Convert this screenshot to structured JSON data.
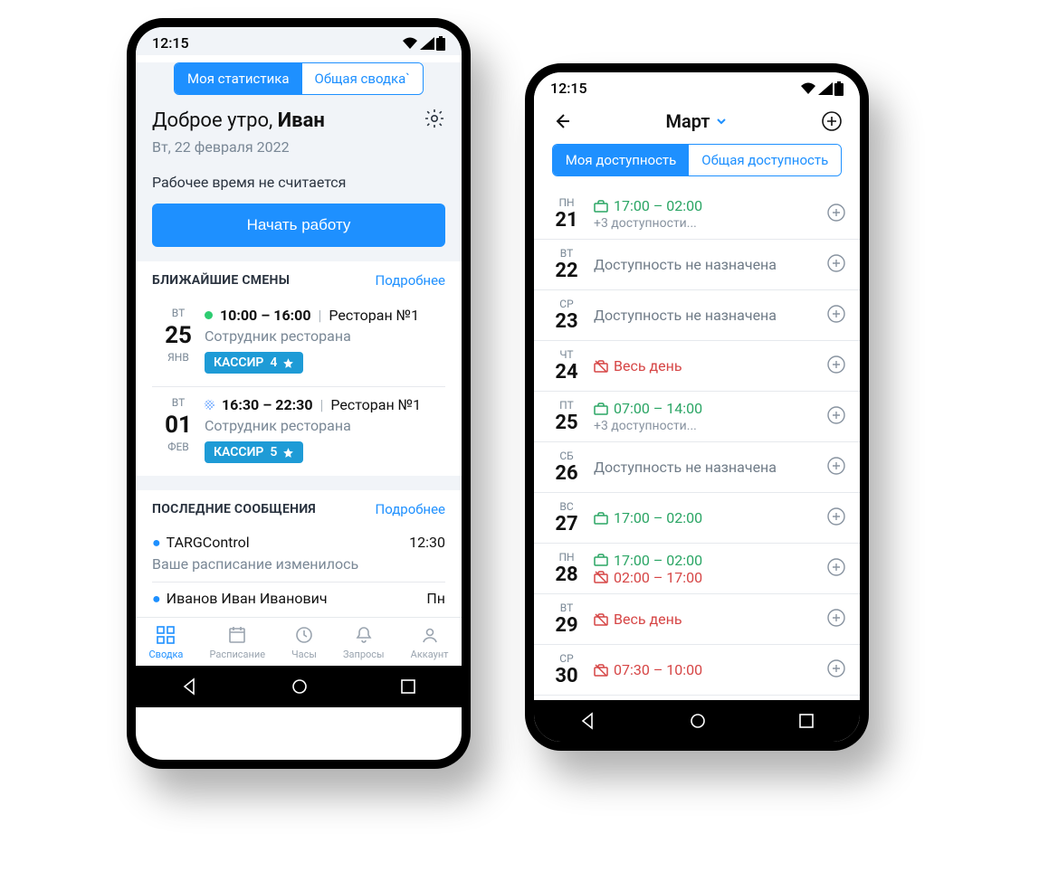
{
  "status": {
    "time": "12:15"
  },
  "left": {
    "tabs": {
      "my": "Моя статистика",
      "overall": "Общая сводка`"
    },
    "greeting_pre": "Доброе утро, ",
    "greeting_name": "Иван",
    "date": "Вт, 22 февраля 2022",
    "worktime": "Рабочее время не считается",
    "start_btn": "Начать работу",
    "shifts_title": "БЛИЖАЙШИЕ СМЕНЫ",
    "more": "Подробнее",
    "shifts": [
      {
        "wd": "ВТ",
        "dn": "25",
        "mn": "ЯНВ",
        "time": "10:00 – 16:00",
        "place": "Ресторан №1",
        "role": "Сотрудник ресторана",
        "badge_text": "КАССИР",
        "badge_num": "4",
        "dot": "green"
      },
      {
        "wd": "ВТ",
        "dn": "01",
        "mn": "ФЕВ",
        "time": "16:30 – 22:30",
        "place": "Ресторан №1",
        "role": "Сотрудник ресторана",
        "badge_text": "КАССИР",
        "badge_num": "5",
        "dot": "pattern"
      }
    ],
    "msgs_title": "ПОСЛЕДНИЕ СООБЩЕНИЯ",
    "msgs": [
      {
        "from": "TARGControl",
        "time": "12:30",
        "text": "Ваше расписание изменилось"
      },
      {
        "from": "Иванов Иван Иванович",
        "time": "Пн",
        "text": ""
      }
    ],
    "tabbar": {
      "summary": "Сводка",
      "schedule": "Расписание",
      "hours": "Часы",
      "requests": "Запросы",
      "account": "Аккаунт"
    }
  },
  "right": {
    "month": "Март",
    "tabs": {
      "my": "Моя доступность",
      "overall": "Общая доступность"
    },
    "none": "Доступность не назначена",
    "more_tpl": "+3 доступности...",
    "days": [
      {
        "wd": "ПН",
        "dn": "21",
        "slots": [
          {
            "t": "green",
            "text": "17:00 – 02:00"
          }
        ],
        "more": true
      },
      {
        "wd": "ВТ",
        "dn": "22",
        "slots": [],
        "more": false
      },
      {
        "wd": "СР",
        "dn": "23",
        "slots": [],
        "more": false
      },
      {
        "wd": "ЧТ",
        "dn": "24",
        "slots": [
          {
            "t": "red",
            "text": "Весь день"
          }
        ],
        "more": false
      },
      {
        "wd": "ПТ",
        "dn": "25",
        "slots": [
          {
            "t": "green",
            "text": "07:00 – 14:00"
          }
        ],
        "more": true
      },
      {
        "wd": "СБ",
        "dn": "26",
        "slots": [],
        "more": false
      },
      {
        "wd": "ВС",
        "dn": "27",
        "slots": [
          {
            "t": "green",
            "text": "17:00 – 02:00"
          }
        ],
        "more": false
      },
      {
        "wd": "ПН",
        "dn": "28",
        "slots": [
          {
            "t": "green",
            "text": "17:00 – 02:00"
          },
          {
            "t": "red",
            "text": "02:00 – 17:00"
          }
        ],
        "more": false
      },
      {
        "wd": "ВТ",
        "dn": "29",
        "slots": [
          {
            "t": "red",
            "text": "Весь день"
          }
        ],
        "more": false
      },
      {
        "wd": "СР",
        "dn": "30",
        "slots": [
          {
            "t": "red",
            "text": "07:30 –  10:00"
          }
        ],
        "more": false
      }
    ]
  }
}
